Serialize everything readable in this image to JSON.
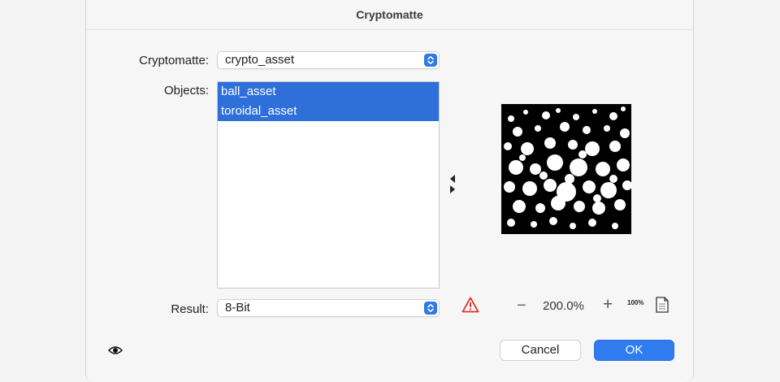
{
  "dialog": {
    "title": "Cryptomatte"
  },
  "cryptomatte": {
    "label": "Cryptomatte:",
    "value": "crypto_asset"
  },
  "objects": {
    "label": "Objects:",
    "items": [
      {
        "label": "ball_asset",
        "selected": true
      },
      {
        "label": "toroidal_asset",
        "selected": true
      }
    ]
  },
  "result": {
    "label": "Result:",
    "value": "8-Bit"
  },
  "zoom": {
    "minus": "−",
    "value": "200.0%",
    "plus": "+",
    "reset": "100%"
  },
  "buttons": {
    "cancel": "Cancel",
    "ok": "OK"
  },
  "colors": {
    "accent": "#2f7cf0",
    "selection": "#2e6fd9",
    "warning": "#e0302a"
  },
  "icons": [
    "popup-stepper-icon",
    "swap-arrows-icon",
    "warning-icon",
    "page-icon",
    "eye-icon"
  ]
}
